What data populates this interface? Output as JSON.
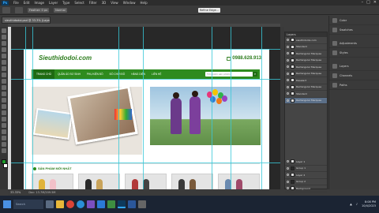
{
  "menubar": {
    "logo": "Ps",
    "items": [
      "File",
      "Edit",
      "Image",
      "Layer",
      "Type",
      "Select",
      "Filter",
      "3D",
      "View",
      "Window",
      "Help"
    ],
    "window_controls": [
      "–",
      "□",
      "✕"
    ]
  },
  "optbar": {
    "feather_label": "Feather: 0 px",
    "style_label": "Normal",
    "refine_label": "Refine Edge..."
  },
  "document": {
    "tab_title": "sieuthidodoi.psd @ 33.3% (Layer..., RGB/8#)",
    "status_zoom": "33.33%",
    "status_doc": "Doc: 13.7M/209.5M"
  },
  "site": {
    "logo": "Sieuthidodoi.com",
    "phone": "0988.628.913",
    "nav": [
      "TRANG CHỦ",
      "QUẦN ÁO SƠ SINH",
      "PHỤ KIỆN ĐỒ",
      "ĐỒ CHƠI ĐỒ",
      "HÀNG DIỆN",
      "LIÊN HỆ"
    ],
    "search_placeholder": "Tìm kiếm sản phẩm",
    "section_title": "SẢN PHẨM MỚI NHẤT"
  },
  "layers_panel": {
    "title": "Layers",
    "items": [
      {
        "name": "sieuthidodoi.com"
      },
      {
        "name": "Standard"
      },
      {
        "name": "Rectangular Marquee"
      },
      {
        "name": "Rectangular Marquee"
      },
      {
        "name": "Rectangular Marquee"
      },
      {
        "name": "Rectangular Marquee"
      },
      {
        "name": "Deselect"
      },
      {
        "name": "Rectangular Marquee"
      },
      {
        "name": "Standard"
      },
      {
        "name": "Rectangular Marquee"
      }
    ],
    "lower_items": [
      {
        "name": "Layer 1"
      },
      {
        "name": "Group 1"
      },
      {
        "name": "Layer 2"
      },
      {
        "name": "Group 2"
      },
      {
        "name": "Background"
      }
    ]
  },
  "dock": {
    "items": [
      "Color",
      "Swatches",
      "Adjustments",
      "Styles",
      "Layers",
      "Channels",
      "Paths"
    ]
  },
  "taskbar": {
    "search_text": "Search",
    "time": "8:08 PM",
    "date": "10/4/2023"
  },
  "colors": {
    "site_green": "#2e8b1e",
    "guide_cyan": "#38c8d8",
    "ps_bg": "#3c3c3c"
  }
}
